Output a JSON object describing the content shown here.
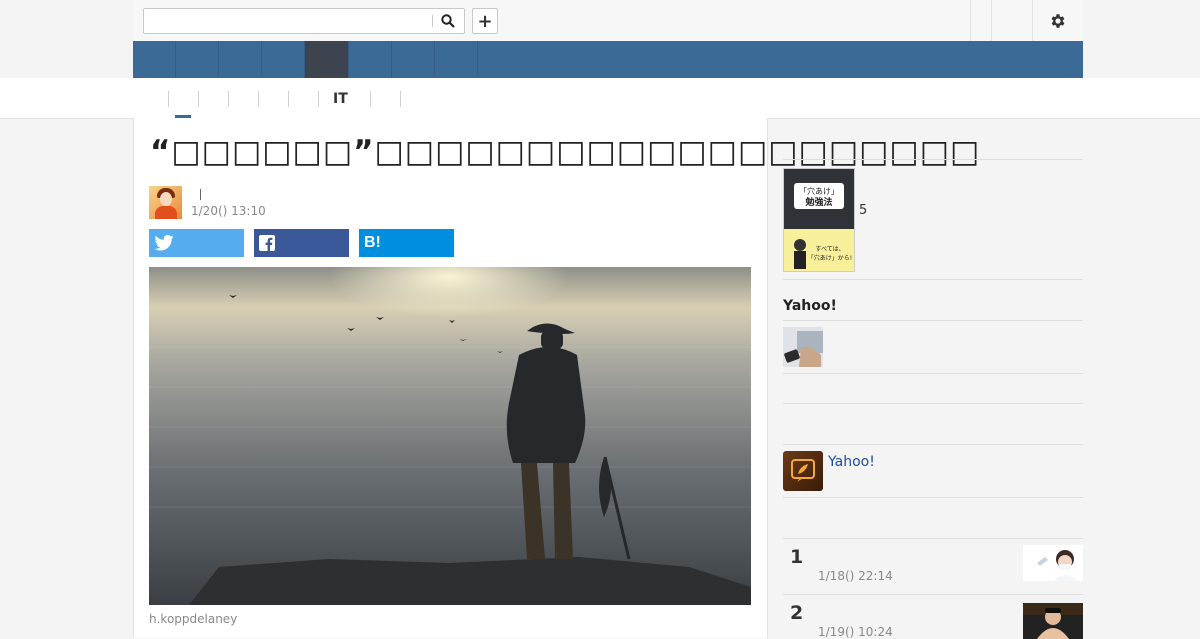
{
  "header": {
    "search": {
      "value": "",
      "placeholder": ""
    },
    "add_label": "+",
    "icons": {
      "search": "search-icon",
      "add": "plus-icon",
      "settings": "gear-icon"
    }
  },
  "nav": {
    "items": [
      "",
      "",
      "",
      "",
      "",
      "",
      "",
      "",
      ""
    ],
    "active_index": 5,
    "color": "#3b6a97",
    "active_color": "#3d4450"
  },
  "subnav": {
    "tabs": [
      "",
      "",
      "",
      "",
      "",
      "IT",
      "",
      ""
    ],
    "active_index": 0
  },
  "article": {
    "title": "“□□□□□□”□□□□□□□□□□□□□□□□□□□□",
    "author_name": "",
    "date": "1/20() 13:10",
    "share": {
      "twitter_label": "",
      "facebook_label": "",
      "hatena_label": "B!",
      "twitter_color": "#55acee",
      "facebook_color": "#3b5998",
      "hatena_color": "#008fde"
    },
    "photo_credit": "h.koppdelaney"
  },
  "sidebar": {
    "book": {
      "count": "5"
    },
    "yahoo_section_title": "Yahoo!",
    "app_link": "Yahoo!",
    "ranking": [
      {
        "rank": "1",
        "title": "",
        "date": "1/18() 22:14"
      },
      {
        "rank": "2",
        "title": "",
        "date": "1/19() 10:24"
      }
    ]
  }
}
